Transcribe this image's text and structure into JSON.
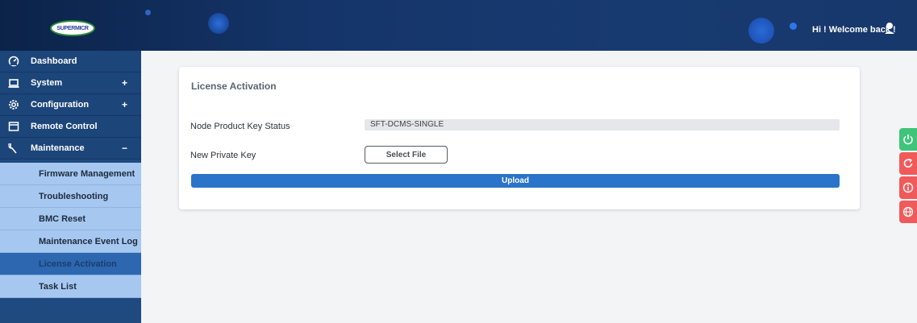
{
  "header": {
    "logo_text": "SUPERMICR",
    "welcome": "Hi ! Welcome back !"
  },
  "sidebar": {
    "items": [
      {
        "label": "Dashboard",
        "icon": "dashboard-icon",
        "toggle": ""
      },
      {
        "label": "System",
        "icon": "laptop-icon",
        "toggle": "+"
      },
      {
        "label": "Configuration",
        "icon": "gear-icon",
        "toggle": "+"
      },
      {
        "label": "Remote Control",
        "icon": "window-icon",
        "toggle": ""
      },
      {
        "label": "Maintenance",
        "icon": "wrench-icon",
        "toggle": "−"
      }
    ],
    "subitems": [
      {
        "label": "Firmware Management"
      },
      {
        "label": "Troubleshooting"
      },
      {
        "label": "BMC Reset"
      },
      {
        "label": "Maintenance Event Log"
      },
      {
        "label": "License Activation",
        "active": true
      },
      {
        "label": "Task List"
      }
    ]
  },
  "main": {
    "title": "License Activation",
    "status_label": "Node Product Key Status",
    "status_value": "SFT-DCMS-SINGLE",
    "private_key_label": "New Private Key",
    "select_file_label": "Select File",
    "upload_label": "Upload"
  },
  "tools": [
    {
      "icon": "power-icon",
      "color": "#3fc47a"
    },
    {
      "icon": "refresh-icon",
      "color": "#f05a5a"
    },
    {
      "icon": "info-icon",
      "color": "#f05a5a"
    },
    {
      "icon": "globe-icon",
      "color": "#f05a5a"
    }
  ],
  "colors": {
    "header": "#15356a",
    "sidebar": "#1c457a",
    "subitem": "#a6c8f0",
    "active": "#2c67b0",
    "upload": "#2a74c9"
  }
}
